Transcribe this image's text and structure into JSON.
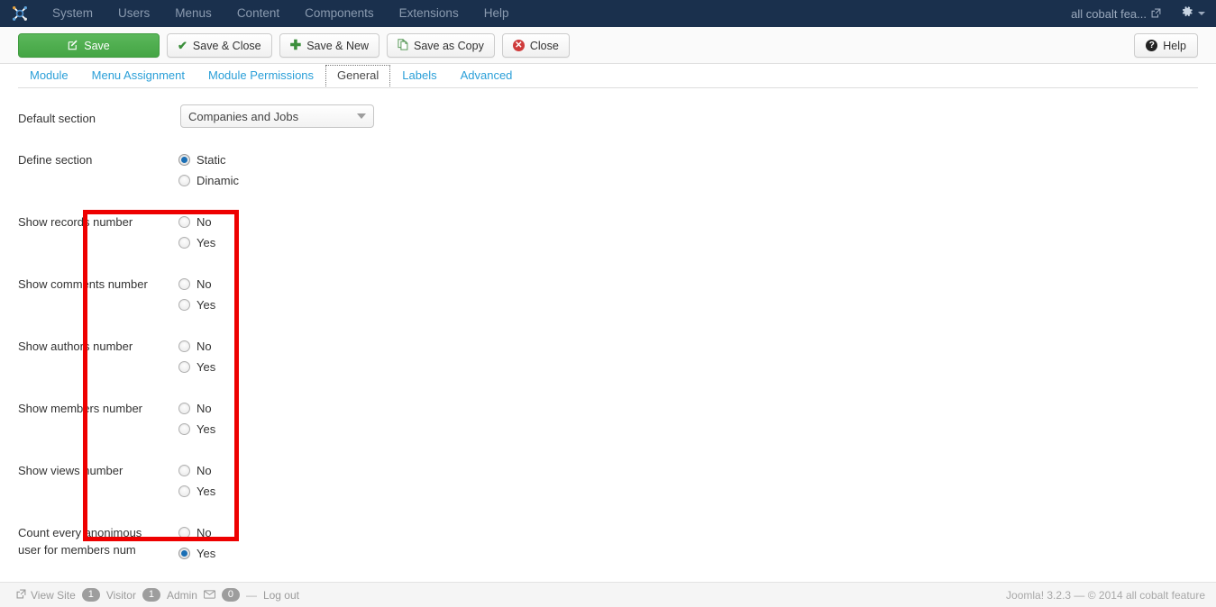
{
  "topbar": {
    "logo_icon": "joomla-logo-icon",
    "nav": [
      {
        "label": "System"
      },
      {
        "label": "Users"
      },
      {
        "label": "Menus"
      },
      {
        "label": "Content"
      },
      {
        "label": "Components"
      },
      {
        "label": "Extensions"
      },
      {
        "label": "Help"
      }
    ],
    "site_name": "all cobalt fea...",
    "external_link_icon": "external-link-icon",
    "gear_icon": "gear-icon",
    "caret_icon": "chevron-down-icon",
    "background_color": "#1a304d",
    "nav_text_color": "#8b9bb0"
  },
  "toolbar": {
    "save_label": "Save",
    "save_close_label": "Save & Close",
    "save_new_label": "Save & New",
    "save_copy_label": "Save as Copy",
    "close_label": "Close",
    "help_label": "Help",
    "save_icon": "pencil-square-icon",
    "save_close_icon": "check-icon",
    "save_new_icon": "plus-icon",
    "save_copy_icon": "copy-icon",
    "close_icon": "close-circle-icon",
    "help_icon": "question-circle-icon",
    "save_button_color": "#44a544"
  },
  "tabs": [
    {
      "label": "Module",
      "active": false
    },
    {
      "label": "Menu Assignment",
      "active": false
    },
    {
      "label": "Module Permissions",
      "active": false
    },
    {
      "label": "General",
      "active": true
    },
    {
      "label": "Labels",
      "active": false
    },
    {
      "label": "Advanced",
      "active": false
    }
  ],
  "tab_link_color": "#2a9fd8",
  "form": {
    "default_section": {
      "label": "Default section",
      "value": "Companies and Jobs",
      "arrow_icon": "chevron-down-icon"
    },
    "define_section": {
      "label": "Define section",
      "options": [
        {
          "text": "Static",
          "checked": true
        },
        {
          "text": "Dinamic",
          "checked": false
        }
      ]
    },
    "show_records_number": {
      "label": "Show records number",
      "options": [
        {
          "text": "No",
          "checked": false
        },
        {
          "text": "Yes",
          "checked": false
        }
      ]
    },
    "show_comments_number": {
      "label": "Show comments number",
      "options": [
        {
          "text": "No",
          "checked": false
        },
        {
          "text": "Yes",
          "checked": false
        }
      ]
    },
    "show_authors_number": {
      "label": "Show authors number",
      "options": [
        {
          "text": "No",
          "checked": false
        },
        {
          "text": "Yes",
          "checked": false
        }
      ]
    },
    "show_members_number": {
      "label": "Show members number",
      "options": [
        {
          "text": "No",
          "checked": false
        },
        {
          "text": "Yes",
          "checked": false
        }
      ]
    },
    "show_views_number": {
      "label": "Show views number",
      "options": [
        {
          "text": "No",
          "checked": false
        },
        {
          "text": "Yes",
          "checked": false
        }
      ]
    },
    "count_anonimous": {
      "label_line1": "Count every anonimous",
      "label_line2": "user for members num",
      "options": [
        {
          "text": "No",
          "checked": false
        },
        {
          "text": "Yes",
          "checked": true
        }
      ]
    }
  },
  "annotation": {
    "type": "red-rectangle-highlight",
    "color": "#ee0000"
  },
  "statusbar": {
    "view_site_label": "View Site",
    "view_site_icon": "external-link-icon",
    "visitor_count": "1",
    "visitor_label": "Visitor",
    "admin_count": "1",
    "admin_label": "Admin",
    "message_icon": "envelope-icon",
    "message_count": "0",
    "separator": "—",
    "logout_label": "Log out",
    "footer_text": "Joomla! 3.2.3  —  © 2014 all cobalt feature"
  }
}
